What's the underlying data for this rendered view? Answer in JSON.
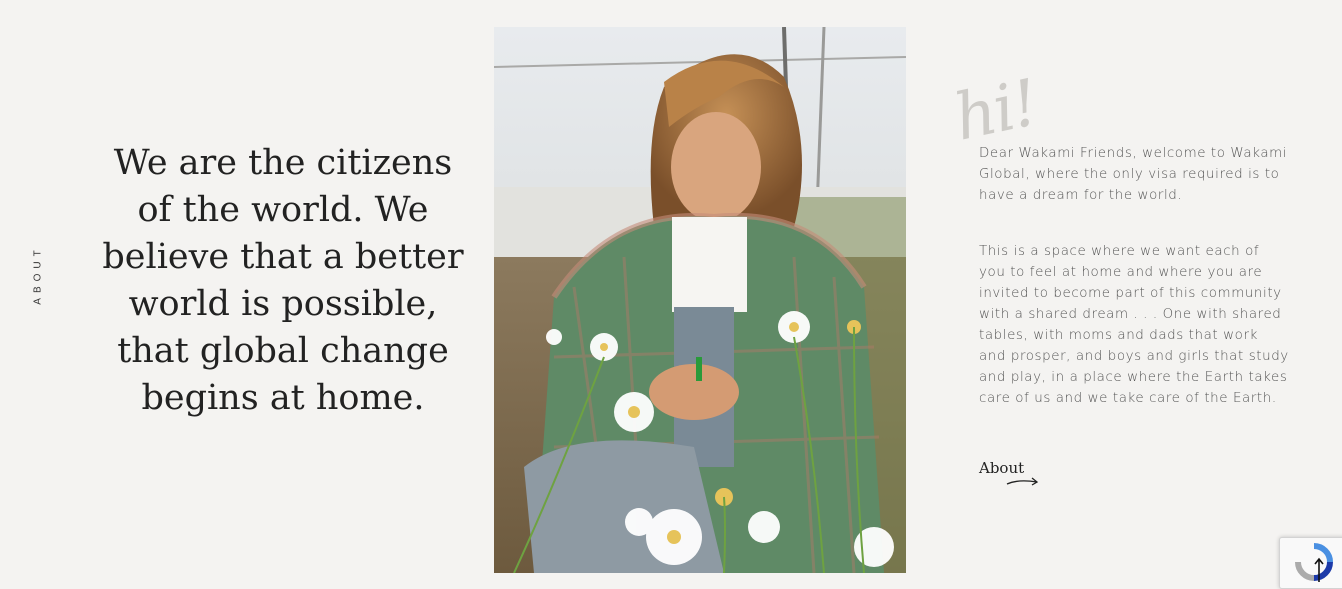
{
  "side_label": "ABOUT",
  "headline": "We are the citizens of the world. We believe that a better world is possible, that global change begins at home.",
  "hi_text": "hi!",
  "paragraphs": [
    "Dear Wakami Friends, welcome to Wakami Global,  where the only visa required is to have a dream for the world.",
    "This is a space where we want each of you to feel at home and where you are invited to become part of this community with a shared dream . . . One with shared tables, with moms and dads that work and prosper, and boys and girls that study and play, in a place where the Earth takes care of us and we take care of the Earth."
  ],
  "about_link": "About",
  "icons": {
    "arrow": "arrow-right-icon",
    "recaptcha": "recaptcha-icon"
  },
  "colors": {
    "background": "#f4f3f1",
    "text": "#222222",
    "muted_text": "#555555"
  }
}
